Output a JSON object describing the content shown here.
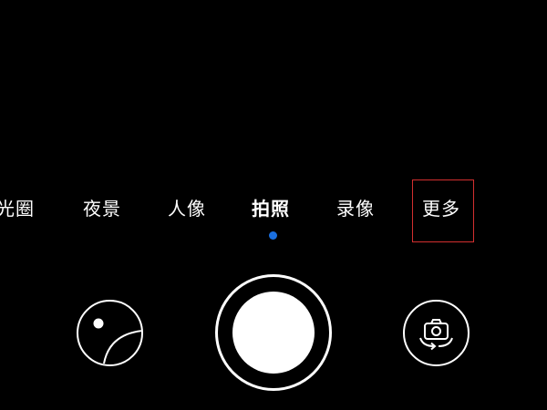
{
  "camera": {
    "modes": [
      {
        "label": "光圈",
        "active": false
      },
      {
        "label": "夜景",
        "active": false
      },
      {
        "label": "人像",
        "active": false
      },
      {
        "label": "拍照",
        "active": true
      },
      {
        "label": "录像",
        "active": false
      },
      {
        "label": "更多",
        "active": false,
        "highlighted": true
      }
    ],
    "active_mode": "拍照",
    "controls": {
      "gallery_icon": "gallery-thumbnail-icon",
      "shutter_icon": "shutter-icon",
      "switch_icon": "switch-camera-icon"
    }
  },
  "colors": {
    "background": "#000000",
    "foreground": "#ffffff",
    "indicator": "#1a6fe0",
    "highlight_box": "#d32f2f"
  }
}
